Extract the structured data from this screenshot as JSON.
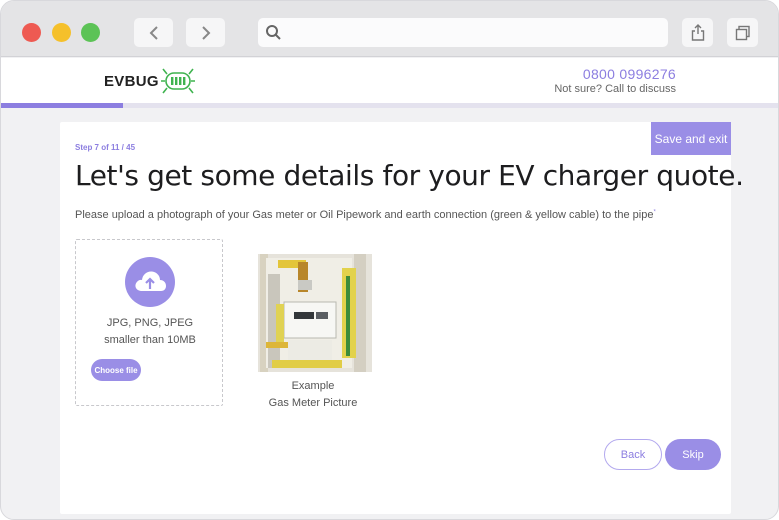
{
  "browser": {
    "controls": [
      "close",
      "minimize",
      "maximize"
    ],
    "nav_icons": [
      "chevron-left-icon",
      "chevron-right-icon"
    ],
    "url_placeholder": "",
    "action_icons": [
      "share-icon",
      "tabs-icon"
    ]
  },
  "header": {
    "logo_text": "EVBUG",
    "phone": "0800 0996276",
    "phone_sub": "Not sure? Call to discuss"
  },
  "progress": {
    "fraction": 0.156,
    "color": "#8c7ee0"
  },
  "card": {
    "save_exit_label": "Save and exit",
    "step_label": "Step 7 of 11 / 45",
    "title": "Let's get some details for your EV charger quote.",
    "instruction": "Please upload a photograph of your Gas meter or Oil Pipework and earth connection (green & yellow cable) to the pipe",
    "required_mark": "*",
    "upload": {
      "icon": "cloud-upload-icon",
      "formats_line1": "JPG, PNG, JPEG",
      "formats_line2": "smaller than 10MB",
      "button_label": "Choose file"
    },
    "example": {
      "caption_line1": "Example",
      "caption_line2": "Gas Meter Picture"
    },
    "buttons": {
      "back_label": "Back",
      "skip_label": "Skip"
    }
  },
  "colors": {
    "accent": "#9a8ee6",
    "accent_text": "#8c7ee0",
    "logo_green": "#3fb34f"
  }
}
